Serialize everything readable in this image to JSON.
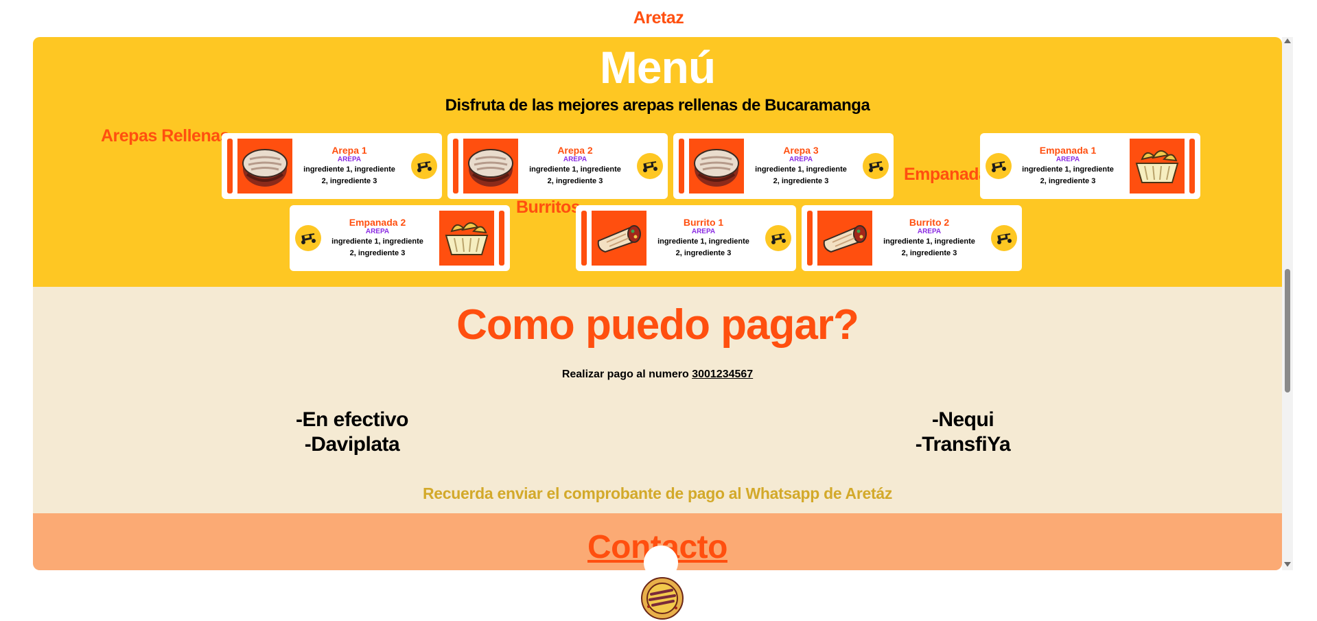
{
  "brand": "Aretaz",
  "menu": {
    "title": "Menú",
    "subtitle": "Disfruta de las mejores arepas rellenas de Bucaramanga",
    "categories": {
      "arepas": "Arepas Rellenas",
      "empanadas": "Empanadas",
      "burritos": "Burritos"
    },
    "items": [
      {
        "name": "Arepa 1",
        "tag": "AREPA",
        "ingredients": "ingrediente 1, ingrediente 2, ingrediente 3",
        "image": "arepa-image",
        "icon": "delivery-moto-icon"
      },
      {
        "name": "Arepa 2",
        "tag": "AREPA",
        "ingredients": "ingrediente 1, ingrediente 2, ingrediente 3",
        "image": "arepa-image",
        "icon": "delivery-moto-icon"
      },
      {
        "name": "Arepa 3",
        "tag": "AREPA",
        "ingredients": "ingrediente 1, ingrediente 2, ingrediente 3",
        "image": "arepa-image",
        "icon": "delivery-moto-icon"
      },
      {
        "name": "Empanada 1",
        "tag": "AREPA",
        "ingredients": "ingrediente 1, ingrediente 2, ingrediente 3",
        "image": "empanada-basket-image",
        "icon": "delivery-moto-icon"
      },
      {
        "name": "Empanada 2",
        "tag": "AREPA",
        "ingredients": "ingrediente 1, ingrediente 2, ingrediente 3",
        "image": "empanada-basket-image",
        "icon": "delivery-moto-icon"
      },
      {
        "name": "Burrito 1",
        "tag": "AREPA",
        "ingredients": "ingrediente 1, ingrediente 2, ingrediente 3",
        "image": "burrito-image",
        "icon": "delivery-moto-icon"
      },
      {
        "name": "Burrito 2",
        "tag": "AREPA",
        "ingredients": "ingrediente 1, ingrediente 2, ingrediente 3",
        "image": "burrito-image",
        "icon": "delivery-moto-icon"
      }
    ]
  },
  "payment": {
    "title": "Como puedo pagar?",
    "instruction": "Realizar pago al numero",
    "phone": "3001234567",
    "methods_left": [
      "-En efectivo",
      "-Daviplata"
    ],
    "methods_right": [
      "-Nequi",
      "-TransfiYa"
    ],
    "note": "Recuerda enviar el comprobante de pago al Whatsapp de Aretáz"
  },
  "contact": {
    "title": "Contacto"
  },
  "colors": {
    "accent": "#ff4f0f",
    "menu_bg": "#fec723",
    "payment_bg": "#f5ead3",
    "contact_bg": "#fbaa74",
    "tag": "#8a2be2",
    "note": "#d3a92a"
  },
  "icons": {
    "delivery": "delivery-moto-icon",
    "logo": "arepa-logo-icon"
  }
}
